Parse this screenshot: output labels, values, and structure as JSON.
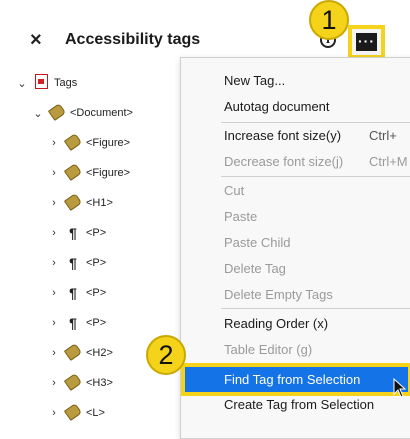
{
  "panel": {
    "title": "Accessibility tags",
    "close_symbol": "×",
    "info_symbol": "i",
    "more_symbol": "···"
  },
  "callouts": {
    "one": "1",
    "two": "2"
  },
  "tree": [
    {
      "label": "Tags",
      "icon": "pdf-icon",
      "expanded": true
    },
    {
      "label": "<Document>",
      "icon": "tag-icon",
      "expanded": true
    },
    {
      "label": "<Figure>",
      "icon": "tag-icon",
      "expanded": false
    },
    {
      "label": "<Figure>",
      "icon": "tag-icon",
      "expanded": false
    },
    {
      "label": "<H1>",
      "icon": "tag-icon",
      "expanded": false
    },
    {
      "label": "<P>",
      "icon": "paragraph-icon",
      "expanded": false
    },
    {
      "label": "<P>",
      "icon": "paragraph-icon",
      "expanded": false
    },
    {
      "label": "<P>",
      "icon": "paragraph-icon",
      "expanded": false
    },
    {
      "label": "<P>",
      "icon": "paragraph-icon",
      "expanded": false
    },
    {
      "label": "<H2>",
      "icon": "tag-icon",
      "expanded": false
    },
    {
      "label": "<H3>",
      "icon": "tag-icon",
      "expanded": false
    },
    {
      "label": "<L>",
      "icon": "tag-icon",
      "expanded": false
    }
  ],
  "menu": {
    "items": [
      {
        "label": "New Tag...",
        "shortcut": "",
        "enabled": true
      },
      {
        "label": "Autotag document",
        "shortcut": "",
        "enabled": true
      },
      {
        "label": "Increase font size(y)",
        "shortcut": "Ctrl+",
        "enabled": true
      },
      {
        "label": "Decrease font size(j)",
        "shortcut": "Ctrl+M",
        "enabled": false
      },
      {
        "label": "Cut",
        "shortcut": "",
        "enabled": false
      },
      {
        "label": "Paste",
        "shortcut": "",
        "enabled": false
      },
      {
        "label": "Paste Child",
        "shortcut": "",
        "enabled": false
      },
      {
        "label": "Delete Tag",
        "shortcut": "",
        "enabled": false
      },
      {
        "label": "Delete Empty Tags",
        "shortcut": "",
        "enabled": false
      },
      {
        "label": "Reading Order (x)",
        "shortcut": "",
        "enabled": true
      },
      {
        "label": "Table Editor (g)",
        "shortcut": "",
        "enabled": false
      },
      {
        "label": "Find Tag from Selection",
        "shortcut": "",
        "enabled": true
      },
      {
        "label": "Create Tag from Selection",
        "shortcut": "",
        "enabled": true
      }
    ]
  },
  "colors": {
    "highlight": "#1473e6",
    "callout": "#f5d31a",
    "tag_icon": "#b99a3e",
    "pdf_icon": "#d32027"
  }
}
